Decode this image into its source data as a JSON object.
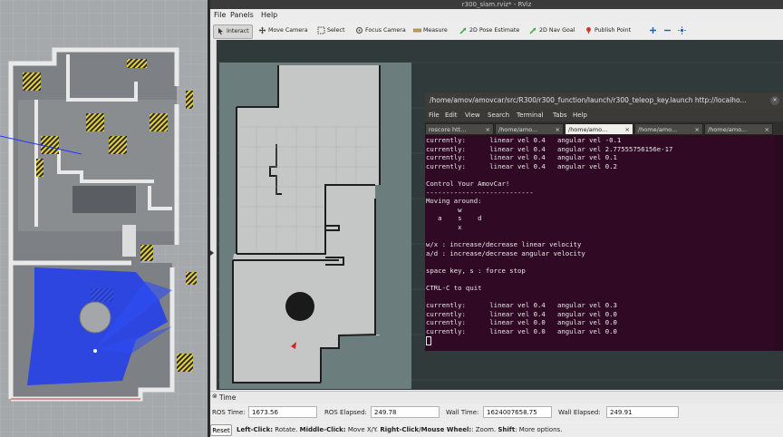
{
  "window": {
    "title": "r300_slam.rviz* - RViz"
  },
  "menu": [
    "File",
    "Panels",
    "Help"
  ],
  "toolbar": {
    "tools": [
      {
        "label": "Interact",
        "icon": "interact-icon"
      },
      {
        "label": "Move Camera",
        "icon": "move-camera-icon"
      },
      {
        "label": "Select",
        "icon": "select-icon"
      },
      {
        "label": "Focus Camera",
        "icon": "focus-camera-icon"
      },
      {
        "label": "Measure",
        "icon": "measure-icon"
      },
      {
        "label": "2D Pose Estimate",
        "icon": "pose-estimate-icon"
      },
      {
        "label": "2D Nav Goal",
        "icon": "nav-goal-icon"
      },
      {
        "label": "Publish Point",
        "icon": "publish-point-icon"
      }
    ],
    "extra_icons": [
      "plus-icon",
      "minus-icon",
      "camera-target-icon"
    ]
  },
  "terminal": {
    "title": "/home/amov/amovcar/src/R300/r300_function/launch/r300_teleop_key.launch http://localho...",
    "menu": [
      "File",
      "Edit",
      "View",
      "Search",
      "Terminal",
      "Tabs",
      "Help"
    ],
    "tabs": [
      "roscore htt...",
      "/home/amo...",
      "/home/amo...",
      "/home/amo...",
      "/home/amo..."
    ],
    "lines": [
      "currently:      linear vel 0.4   angular vel -0.1",
      "currently:      linear vel 0.4   angular vel 2.77555756156e-17",
      "currently:      linear vel 0.4   angular vel 0.1",
      "currently:      linear vel 0.4   angular vel 0.2",
      "",
      "Control Your AmovCar!",
      "---------------------------",
      "Moving around:",
      "        w",
      "   a    s    d",
      "        x",
      "",
      "w/x : increase/decrease linear velocity",
      "a/d : increase/decrease angular velocity",
      "",
      "space key, s : force stop",
      "",
      "CTRL-C to quit",
      "",
      "currently:      linear vel 0.4   angular vel 0.3",
      "currently:      linear vel 0.4   angular vel 0.0",
      "currently:      linear vel 0.0   angular vel 0.0",
      "currently:      linear vel 0.0   angular vel 0.0"
    ]
  },
  "time_panel": {
    "title": "Time",
    "close": "⊗",
    "ros_time_label": "ROS Time:",
    "ros_time": "1673.56",
    "ros_elapsed_label": "ROS Elapsed:",
    "ros_elapsed": "249.78",
    "wall_time_label": "Wall Time:",
    "wall_time": "1624007658.75",
    "wall_elapsed_label": "Wall Elapsed:",
    "wall_elapsed": "249.91"
  },
  "status": {
    "reset": "Reset",
    "hint_bold_1": "Left-Click:",
    "hint_1": " Rotate. ",
    "hint_bold_2": "Middle-Click:",
    "hint_2": " Move X/Y. ",
    "hint_bold_3": "Right-Click/Mouse Wheel:",
    "hint_3": ": Zoom. ",
    "hint_bold_4": "Shift",
    "hint_4": ": More options."
  }
}
